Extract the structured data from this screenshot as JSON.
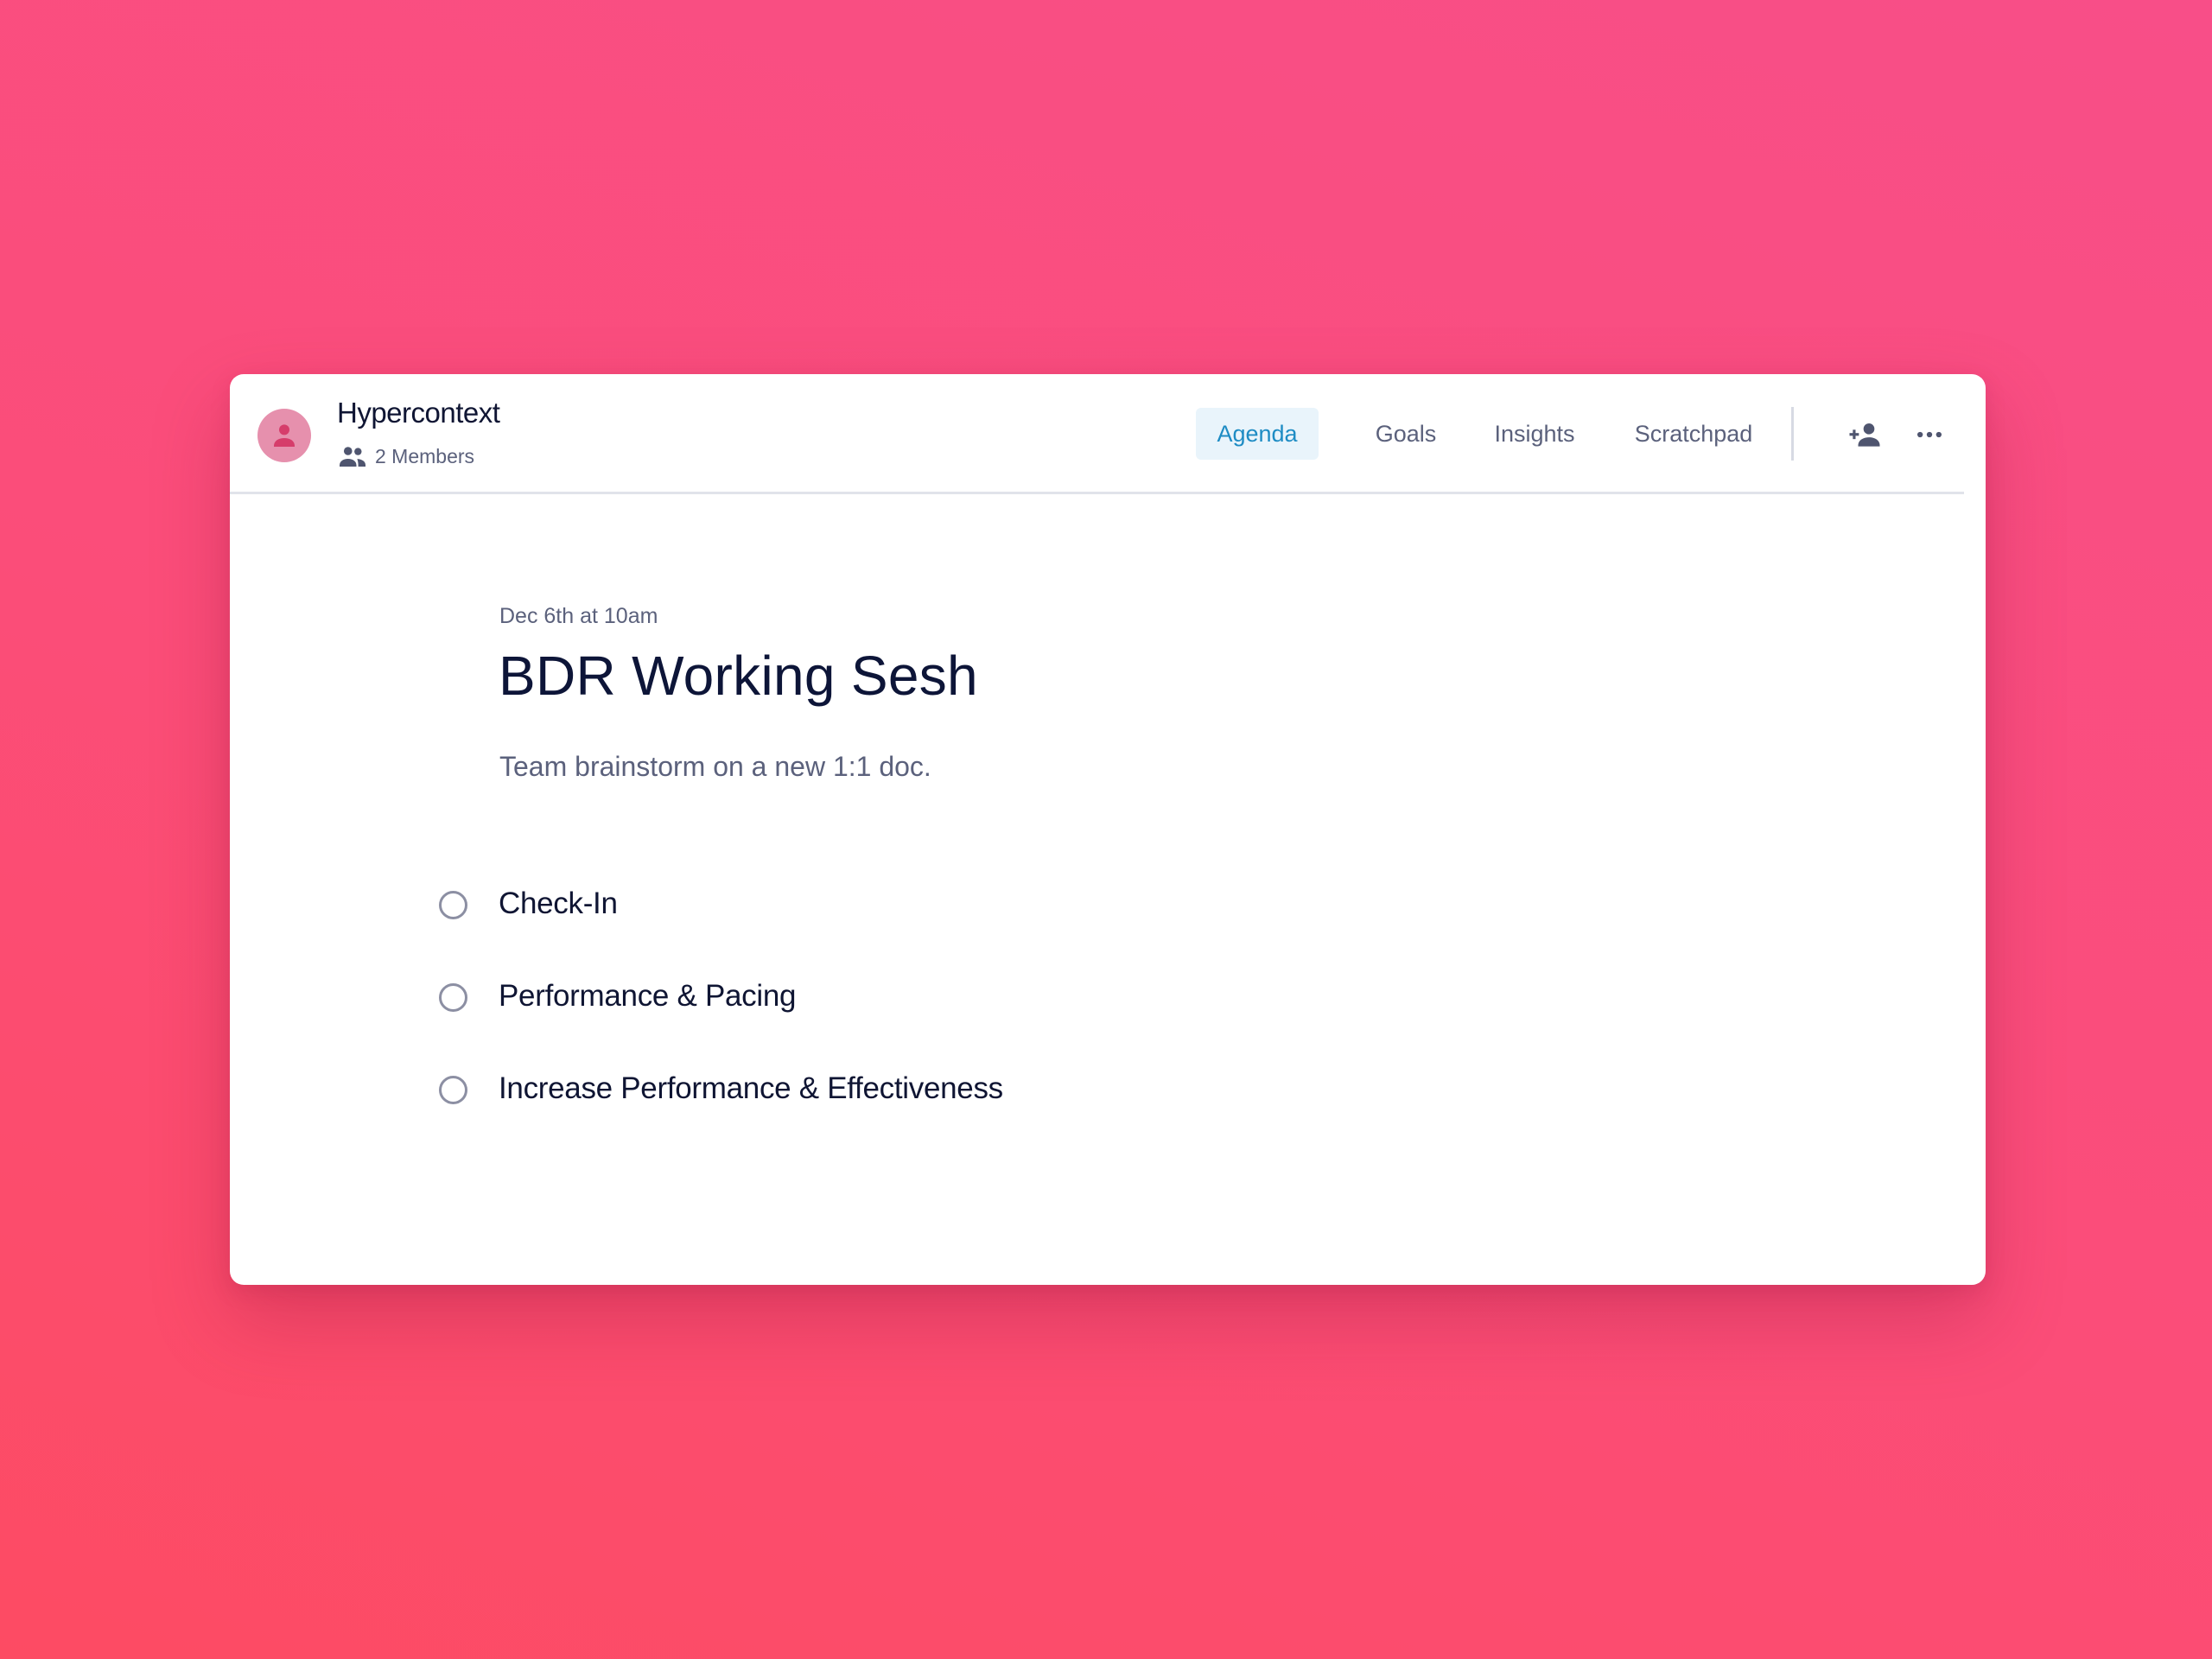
{
  "colors": {
    "background_top": "#f84e88",
    "background_bottom": "#fd4b63",
    "accent": "#1e8cc4",
    "accent_bg": "#e9f4fb",
    "avatar_bg": "#e690ad",
    "avatar_icon": "#d63d6b",
    "text_primary": "#0f1533",
    "text_secondary": "#5b617c"
  },
  "header": {
    "team_name": "Hypercontext",
    "members_label": "2 Members",
    "avatar_icon": "person-icon",
    "members_icon": "people-icon",
    "tabs": [
      {
        "label": "Agenda",
        "active": true
      },
      {
        "label": "Goals",
        "active": false
      },
      {
        "label": "Insights",
        "active": false
      },
      {
        "label": "Scratchpad",
        "active": false
      }
    ],
    "actions": [
      {
        "icon": "add-person-icon"
      },
      {
        "icon": "more-horizontal-icon"
      }
    ]
  },
  "meeting": {
    "date": "Dec 6th at 10am",
    "title": "BDR Working Sesh",
    "description": "Team brainstorm on a new 1:1 doc."
  },
  "agenda": {
    "items": [
      {
        "label": "Check-In",
        "checked": false
      },
      {
        "label": "Performance & Pacing",
        "checked": false
      },
      {
        "label": "Increase Performance & Effectiveness",
        "checked": false
      }
    ]
  }
}
